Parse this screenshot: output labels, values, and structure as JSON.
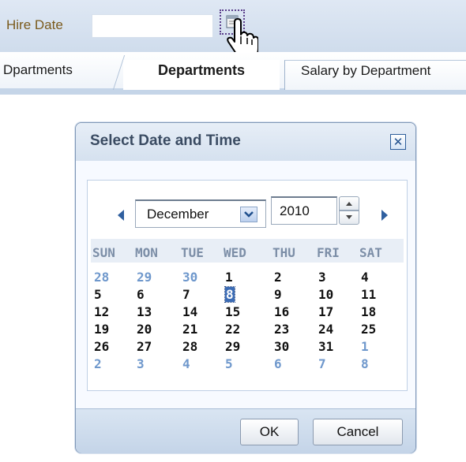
{
  "form": {
    "hire_date_label": "Hire Date",
    "hire_date_value": ""
  },
  "tabs": [
    {
      "label": "Dpartments"
    },
    {
      "label": "Departments"
    },
    {
      "label": "Salary by Department"
    }
  ],
  "dialog": {
    "title": "Select Date and Time",
    "close_glyph": "✕",
    "month": "December",
    "year": "2010",
    "weekdays": [
      "SUN",
      "MON",
      "TUE",
      "WED",
      "THU",
      "FRI",
      "SAT"
    ],
    "weeks": [
      [
        {
          "d": "28",
          "other": true
        },
        {
          "d": "29",
          "other": true
        },
        {
          "d": "30",
          "other": true
        },
        {
          "d": "1"
        },
        {
          "d": "2"
        },
        {
          "d": "3"
        },
        {
          "d": "4"
        }
      ],
      [
        {
          "d": "5"
        },
        {
          "d": "6"
        },
        {
          "d": "7"
        },
        {
          "d": "8",
          "selected": true
        },
        {
          "d": "9"
        },
        {
          "d": "10"
        },
        {
          "d": "11"
        }
      ],
      [
        {
          "d": "12"
        },
        {
          "d": "13"
        },
        {
          "d": "14"
        },
        {
          "d": "15"
        },
        {
          "d": "16"
        },
        {
          "d": "17"
        },
        {
          "d": "18"
        }
      ],
      [
        {
          "d": "19"
        },
        {
          "d": "20"
        },
        {
          "d": "21"
        },
        {
          "d": "22"
        },
        {
          "d": "23"
        },
        {
          "d": "24"
        },
        {
          "d": "25"
        }
      ],
      [
        {
          "d": "26"
        },
        {
          "d": "27"
        },
        {
          "d": "28"
        },
        {
          "d": "29"
        },
        {
          "d": "30"
        },
        {
          "d": "31"
        },
        {
          "d": "1",
          "other": true
        }
      ],
      [
        {
          "d": "2",
          "other": true
        },
        {
          "d": "3",
          "other": true
        },
        {
          "d": "4",
          "other": true
        },
        {
          "d": "5",
          "other": true
        },
        {
          "d": "6",
          "other": true
        },
        {
          "d": "7",
          "other": true
        },
        {
          "d": "8",
          "other": true
        }
      ]
    ],
    "ok_label": "OK",
    "cancel_label": "Cancel"
  },
  "colors": {
    "accent": "#3c6cb5",
    "other_month_day": "#6f98cc",
    "label_gold": "#7a5a1c"
  }
}
